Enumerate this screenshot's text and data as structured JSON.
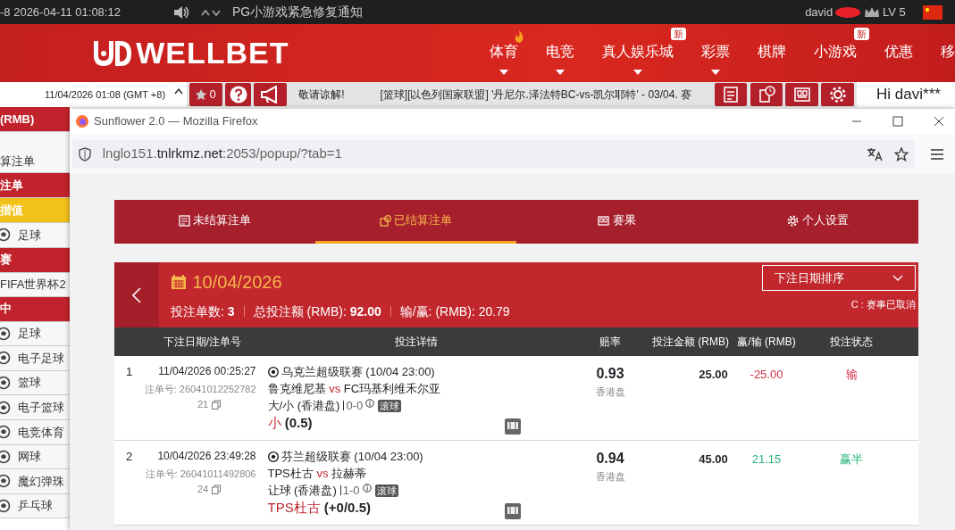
{
  "top_bar": {
    "clock": "-8 2026-04-11 01:08:12",
    "notice": "PG小游戏紧急修复通知",
    "username": "david",
    "level": "LV 5"
  },
  "nav": {
    "logo": "WELLBET",
    "items": [
      {
        "label": "体育",
        "hot": true,
        "dropdown": true
      },
      {
        "label": "电竞",
        "hot": false,
        "dropdown": true
      },
      {
        "label": "真人娱乐城",
        "hot": false,
        "dropdown": true,
        "badge": "新"
      },
      {
        "label": "彩票",
        "hot": false,
        "dropdown": true
      },
      {
        "label": "棋牌",
        "hot": false,
        "dropdown": false
      },
      {
        "label": "小游戏",
        "hot": false,
        "dropdown": false,
        "badge": "新"
      },
      {
        "label": "优惠",
        "hot": false,
        "dropdown": false
      },
      {
        "label": "移",
        "hot": false,
        "dropdown": false
      }
    ]
  },
  "sub_bar": {
    "time": "11/04/2026 01:08 (GMT +8)",
    "favorites_count": "0",
    "marquee": [
      "敬请谅解!",
      "[篮球][以色列国家联盟] '丹尼尔.泽法特BC-vs-凯尔耶特' - 03/04. 赛"
    ],
    "greeting": "Hi davi***"
  },
  "sidebar": [
    {
      "kind": "header",
      "label": "(RMB)",
      "selected": false
    },
    {
      "kind": "link",
      "label": "算注单"
    },
    {
      "kind": "header",
      "label": "注单",
      "selected": false
    },
    {
      "kind": "header",
      "label": "揩值",
      "selected": true
    },
    {
      "kind": "sport",
      "label": "足球"
    },
    {
      "kind": "header",
      "label": "赛",
      "selected": false
    },
    {
      "kind": "link",
      "label": "FIFA世界杯2"
    },
    {
      "kind": "header",
      "label": "中",
      "selected": false
    },
    {
      "kind": "sport",
      "label": "足球"
    },
    {
      "kind": "sport",
      "label": "电子足球"
    },
    {
      "kind": "sport",
      "label": "篮球"
    },
    {
      "kind": "sport",
      "label": "电子篮球"
    },
    {
      "kind": "sport",
      "label": "电竞体育"
    },
    {
      "kind": "sport",
      "label": "网球"
    },
    {
      "kind": "sport",
      "label": "魔幻弹珠"
    },
    {
      "kind": "sport",
      "label": "乒乓球"
    }
  ],
  "browser": {
    "title": "Sunflower 2.0 — Mozilla Firefox",
    "url": {
      "prefix": "lnglo151.",
      "domain": "tnlrkmz.net",
      "suffix": ":2053/popup/?tab=1"
    }
  },
  "tabs": [
    {
      "label": "未结算注单",
      "selected": false
    },
    {
      "label": "已结算注单",
      "selected": true
    },
    {
      "label": "赛果",
      "selected": false
    },
    {
      "label": "个人设置",
      "selected": false
    }
  ],
  "summary": {
    "date": "10/04/2026",
    "stats": [
      {
        "label": "投注单数:",
        "value": "3",
        "bold": true
      },
      {
        "label": "总投注额 (RMB):",
        "value": "92.00",
        "bold": true
      },
      {
        "label": "输/赢: (RMB):",
        "value": "20.79",
        "bold": false
      }
    ],
    "sort": "下注日期排序",
    "note": "C : 赛事已取消"
  },
  "table": {
    "columns": [
      "下注日期/注单号",
      "投注详情",
      "赔率",
      "投注金额 (RMB)",
      "赢/输 (RMB)",
      "投注状态"
    ],
    "rows": [
      {
        "index": "1",
        "datetime": "11/04/2026 00:25:27",
        "ticket": "注单号: 26041012252782",
        "count": "21",
        "league": "乌克兰超级联赛 (10/04 23:00)",
        "home": "鲁克维尼基",
        "vs": "vs",
        "away": "FC玛基利维禾尔亚",
        "market": "大/小 (香港盘)",
        "score": "0-0",
        "tag": "滚球",
        "pick": "小",
        "line": "(0.5)",
        "odds": "0.93",
        "odds_type": "香港盘",
        "stake": "25.00",
        "winloss": "-25.00",
        "color": "#d32f45",
        "status": "输"
      },
      {
        "index": "2",
        "datetime": "10/04/2026 23:49:28",
        "ticket": "注单号: 26041011492806",
        "count": "24",
        "league": "芬兰超级联赛 (10/04 23:00)",
        "home": "TPS杜古",
        "vs": "vs",
        "away": "拉赫蒂",
        "market": "让球 (香港盘)",
        "score": "1-0",
        "tag": "滚球",
        "pick": "TPS杜古",
        "line": "(+0/0.5)",
        "odds": "0.94",
        "odds_type": "香港盘",
        "stake": "45.00",
        "winloss": "21.15",
        "color": "#27b57a",
        "status": "赢半"
      }
    ]
  }
}
